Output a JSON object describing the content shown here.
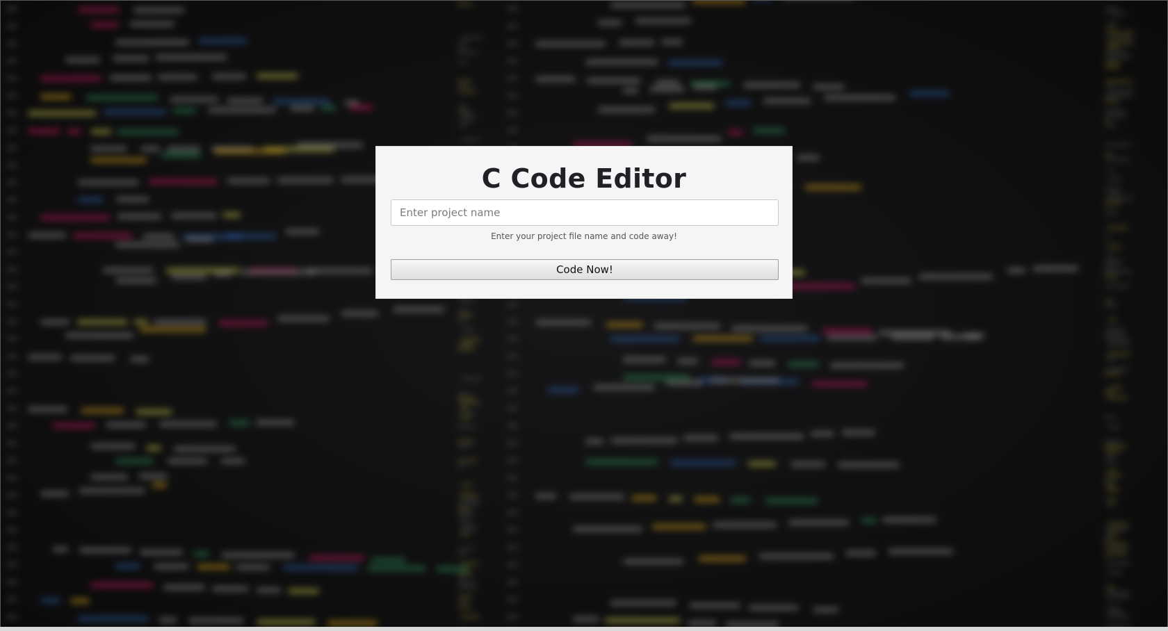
{
  "modal": {
    "title": "C Code Editor",
    "project_input": {
      "value": "",
      "placeholder": "Enter project name"
    },
    "helper_text": "Enter your project file name and code away!",
    "submit_label": "Code Now!"
  },
  "colors": {
    "modal_background": "#f5f5f5",
    "page_background": "#0f0f10",
    "title_color": "#1f2126",
    "code_syntax": [
      "#c2185b",
      "#2e5fa8",
      "#c6c24a",
      "#8a8a8a",
      "#2e8b57",
      "#d4a017"
    ]
  }
}
